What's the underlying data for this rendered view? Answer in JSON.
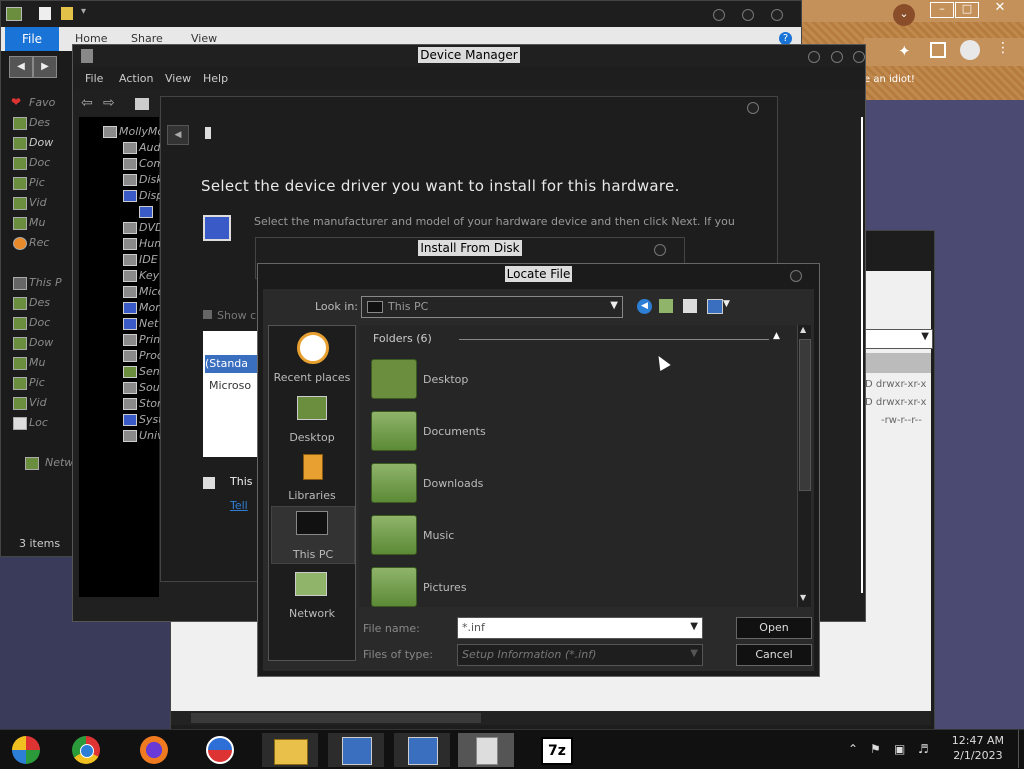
{
  "explorer": {
    "ribbon_file": "File",
    "ribbon_tabs": [
      "Home",
      "Share",
      "View"
    ],
    "sidebar": [
      {
        "label": "Favo",
        "icon": "heart-icon"
      },
      {
        "label": "Des",
        "icon": "desktop-icon"
      },
      {
        "label": "Dow",
        "icon": "downloads-icon"
      },
      {
        "label": "Doc",
        "icon": "documents-icon"
      },
      {
        "label": "Pic",
        "icon": "pictures-icon"
      },
      {
        "label": "Vid",
        "icon": "videos-icon"
      },
      {
        "label": "Mu",
        "icon": "music-icon"
      },
      {
        "label": "Rec",
        "icon": "recent-icon"
      },
      {
        "label": "This P",
        "icon": "computer-icon"
      },
      {
        "label": "Des",
        "icon": "desktop-icon"
      },
      {
        "label": "Doc",
        "icon": "documents-icon"
      },
      {
        "label": "Dow",
        "icon": "downloads-icon"
      },
      {
        "label": "Mu",
        "icon": "music-icon"
      },
      {
        "label": "Pic",
        "icon": "pictures-icon"
      },
      {
        "label": "Vid",
        "icon": "videos-icon"
      },
      {
        "label": "Loc",
        "icon": "drive-icon"
      },
      {
        "label": "Netw",
        "icon": "network-icon"
      }
    ],
    "status": "3 items"
  },
  "device_manager": {
    "title": "Device Manager",
    "menu": [
      "File",
      "Action",
      "View",
      "Help"
    ],
    "root": "MollyMo",
    "tree": [
      "Aud",
      "Com",
      "Disk",
      "Disp",
      "",
      "DVD",
      "Hum",
      "IDE",
      "Key",
      "Mice",
      "Mon",
      "Net",
      "Prin",
      "Proc",
      "Sens",
      "Sour",
      "Stor",
      "Syst",
      "Univ"
    ]
  },
  "driver_dialog": {
    "heading": "Select the device driver you want to install for this hardware.",
    "description": "Select the manufacturer and model of your hardware device and then click Next. If you",
    "show_compatible": "Show c",
    "list_items": [
      "(Standa",
      "Microso"
    ],
    "signed_text": "This",
    "tell_link": "Tell"
  },
  "install_from_disk": {
    "title": "Install From Disk"
  },
  "locate_file": {
    "title": "Locate File",
    "look_in_label": "Look in:",
    "look_in_value": "This PC",
    "places": [
      {
        "label": "Recent places",
        "icon": "clock-icon"
      },
      {
        "label": "Desktop",
        "icon": "desktop-icon"
      },
      {
        "label": "Libraries",
        "icon": "libraries-icon"
      },
      {
        "label": "This PC",
        "icon": "monitor-icon"
      },
      {
        "label": "Network",
        "icon": "network-icon"
      }
    ],
    "group_header": "Folders (6)",
    "folders": [
      "Desktop",
      "Documents",
      "Downloads",
      "Music",
      "Pictures"
    ],
    "file_name_label": "File name:",
    "file_name_value": "*.inf",
    "file_type_label": "Files of type:",
    "file_type_value": "Setup Information (*.inf)",
    "open_label": "Open",
    "cancel_label": "Cancel"
  },
  "right_window": {
    "perms": [
      "drwxr-xr-x",
      "drwxr-xr-x",
      "-rw-r--r--"
    ],
    "perm_prefix": [
      "D",
      "D",
      ""
    ]
  },
  "browser_snippet": "e an idiot!",
  "taskbar": {
    "apps": [
      {
        "name": "start-icon"
      },
      {
        "name": "chrome-icon"
      },
      {
        "name": "firefox-icon"
      },
      {
        "name": "obama-logo-icon"
      },
      {
        "name": "file-explorer-icon"
      },
      {
        "name": "device-setup-icon"
      },
      {
        "name": "device-setup-icon-2"
      },
      {
        "name": "usb-icon"
      },
      {
        "name": "7zip-icon"
      }
    ],
    "sevenzip_label": "7z",
    "time": "12:47 AM",
    "date": "2/1/2023"
  }
}
